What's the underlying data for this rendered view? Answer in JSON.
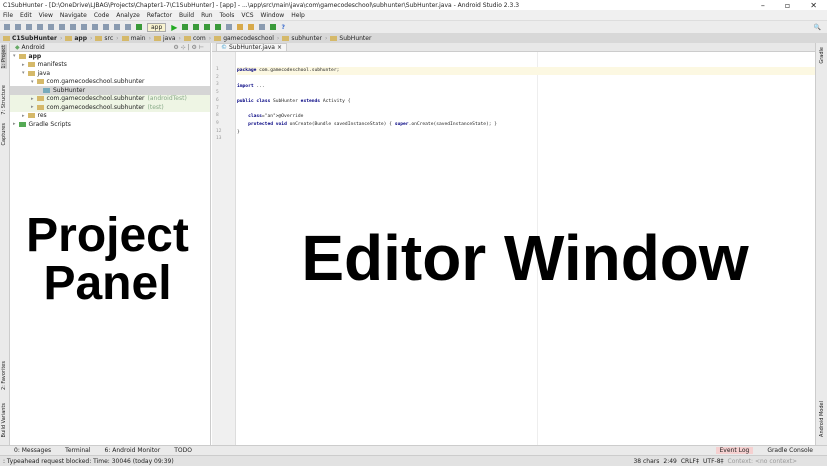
{
  "title": "C1SubHunter - [D:\\OneDrive\\LJBAG\\Projects\\Chapter1-7\\C1SubHunter] - [app] - ...\\app\\src\\main\\java\\com\\gamecodeschool\\subhunter\\SubHunter.java - Android Studio 2.3.3",
  "menu": [
    "File",
    "Edit",
    "View",
    "Navigate",
    "Code",
    "Analyze",
    "Refactor",
    "Build",
    "Run",
    "Tools",
    "VCS",
    "Window",
    "Help"
  ],
  "toolbar": {
    "run_config": "app"
  },
  "breadcrumbs": [
    "C1SubHunter",
    "app",
    "src",
    "main",
    "java",
    "com",
    "gamecodeschool",
    "subhunter",
    "SubHunter"
  ],
  "project": {
    "view": "Android",
    "tree": [
      {
        "label": "app",
        "suffix": ""
      },
      {
        "label": "manifests",
        "suffix": ""
      },
      {
        "label": "java",
        "suffix": ""
      },
      {
        "label": "com.gamecodeschool.subhunter",
        "suffix": ""
      },
      {
        "label": "SubHunter",
        "suffix": ""
      },
      {
        "label": "com.gamecodeschool.subhunter",
        "suffix": "(androidTest)"
      },
      {
        "label": "com.gamecodeschool.subhunter",
        "suffix": "(test)"
      },
      {
        "label": "res",
        "suffix": ""
      },
      {
        "label": "Gradle Scripts",
        "suffix": ""
      }
    ]
  },
  "left_tools": [
    "1: Project",
    "7: Structure",
    "Captures",
    "2: Favorites",
    "Build Variants"
  ],
  "right_tools": [
    "Gradle",
    "Android Model"
  ],
  "editor": {
    "tab": "SubHunter.java",
    "line_numbers": [
      "1",
      "2",
      "3",
      "5",
      "6",
      "7",
      "8",
      "9",
      "12",
      "13"
    ],
    "lines": [
      "package com.gamecodeschool.subhunter;",
      "",
      "import ...",
      "",
      "public class SubHunter extends Activity {",
      "",
      "    @Override",
      "    protected void onCreate(Bundle savedInstanceState) { super.onCreate(savedInstanceState); }",
      "}",
      ""
    ]
  },
  "bottom_tools": [
    "0: Messages",
    "Terminal",
    "6: Android Monitor",
    "TODO"
  ],
  "bottom_right_tools": [
    "Event Log",
    "Gradle Console"
  ],
  "status": {
    "message": ": Typeahead request blocked: Time: 30046 (today 09:39)",
    "chars": "38 chars",
    "position": "2:49",
    "line_sep": "CRLF‡",
    "encoding": "UTF-8‡",
    "context": "Context: <no context>"
  },
  "overlay": {
    "project": "Project Panel",
    "editor": "Editor Window"
  }
}
